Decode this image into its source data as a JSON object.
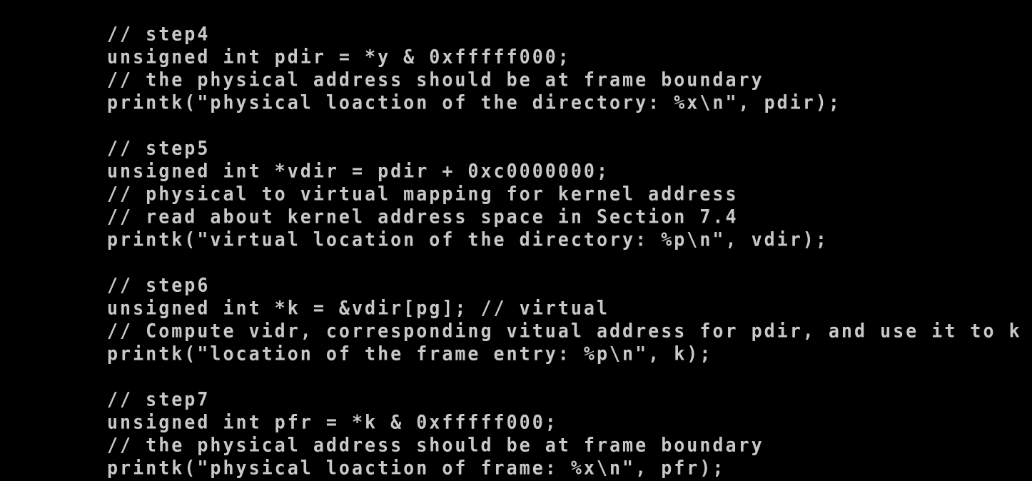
{
  "terminal": {
    "background": "#000000",
    "text_color": "#c8c8c8",
    "lines": [
      "// step4",
      "unsigned int pdir = *y & 0xfffff000;",
      "// the physical address should be at frame boundary",
      "printk(\"physical loaction of the directory: %x\\n\", pdir);",
      "",
      "// step5",
      "unsigned int *vdir = pdir + 0xc0000000;",
      "// physical to virtual mapping for kernel address",
      "// read about kernel address space in Section 7.4",
      "printk(\"virtual location of the directory: %p\\n\", vdir);",
      "",
      "// step6",
      "unsigned int *k = &vdir[pg]; // virtual",
      "// Compute vidr, corresponding vitual address for pdir, and use it to k",
      "printk(\"location of the frame entry: %p\\n\", k);",
      "",
      "// step7",
      "unsigned int pfr = *k & 0xfffff000;",
      "// the physical address should be at frame boundary",
      "printk(\"physical loaction of frame: %x\\n\", pfr);"
    ]
  }
}
